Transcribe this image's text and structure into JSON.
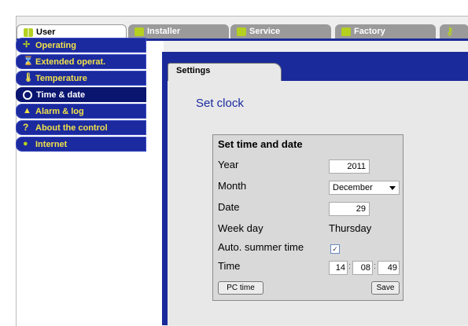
{
  "top_tabs": [
    {
      "label": "User",
      "icon": "users-icon",
      "active": true
    },
    {
      "label": "Installer",
      "icon": "installer-icon",
      "active": false
    },
    {
      "label": "Service",
      "icon": "service-icon",
      "active": false
    },
    {
      "label": "Factory",
      "icon": "factory-icon",
      "active": false
    }
  ],
  "menu": [
    {
      "label": "Operating",
      "icon": "operating-icon"
    },
    {
      "label": "Extended operat.",
      "icon": "hourglass-icon"
    },
    {
      "label": "Temperature",
      "icon": "thermometer-icon"
    },
    {
      "label": "Time & date",
      "icon": "clock-icon",
      "active": true
    },
    {
      "label": "Alarm & log",
      "icon": "bell-icon"
    },
    {
      "label": "About the control",
      "icon": "question-icon"
    },
    {
      "label": "Internet",
      "icon": "globe-icon"
    }
  ],
  "content_tab": "Settings",
  "page_title": "Set clock",
  "form": {
    "title": "Set time and date",
    "year_label": "Year",
    "year_value": "2011",
    "month_label": "Month",
    "month_value": "December",
    "date_label": "Date",
    "date_value": "29",
    "weekday_label": "Week day",
    "weekday_value": "Thursday",
    "summer_label": "Auto. summer time",
    "summer_checked": true,
    "time_label": "Time",
    "hour": "14",
    "minute": "08",
    "second": "49",
    "time_sep": ":",
    "pc_time_button": "PC time",
    "save_button": "Save"
  },
  "colors": {
    "accent_blue": "#1a2a9a",
    "menu_text": "#f2e24a",
    "icon_green": "#b5d020"
  }
}
